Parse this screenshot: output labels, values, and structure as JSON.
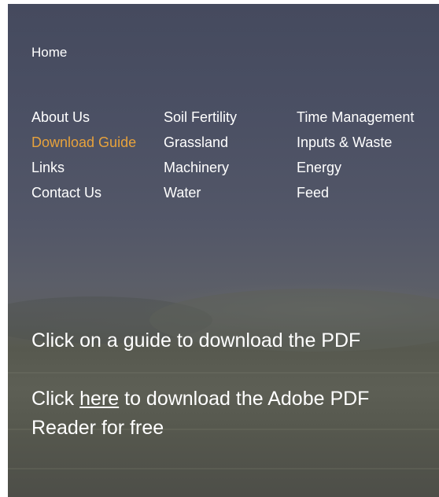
{
  "nav": {
    "home": "Home"
  },
  "menu": {
    "col1": [
      {
        "label": "About Us"
      },
      {
        "label": "Download Guide"
      },
      {
        "label": "Links"
      },
      {
        "label": "Contact Us"
      }
    ],
    "col2": [
      {
        "label": "Soil Fertility"
      },
      {
        "label": "Grassland"
      },
      {
        "label": "Machinery"
      },
      {
        "label": "Water"
      }
    ],
    "col3": [
      {
        "label": "Time Management"
      },
      {
        "label": "Inputs & Waste"
      },
      {
        "label": "Energy"
      },
      {
        "label": "Feed"
      }
    ],
    "active_item": "Download Guide"
  },
  "info": {
    "guide_text": "Click on a guide to download the PDF",
    "adobe_prefix": "Click",
    "adobe_link": "here",
    "adobe_suffix_line1": "to download the Adobe PDF",
    "adobe_suffix_line2": "Reader for free"
  },
  "colors": {
    "text": "#ffffff",
    "active": "#e7a23c",
    "overlay": "#4a4f63"
  }
}
